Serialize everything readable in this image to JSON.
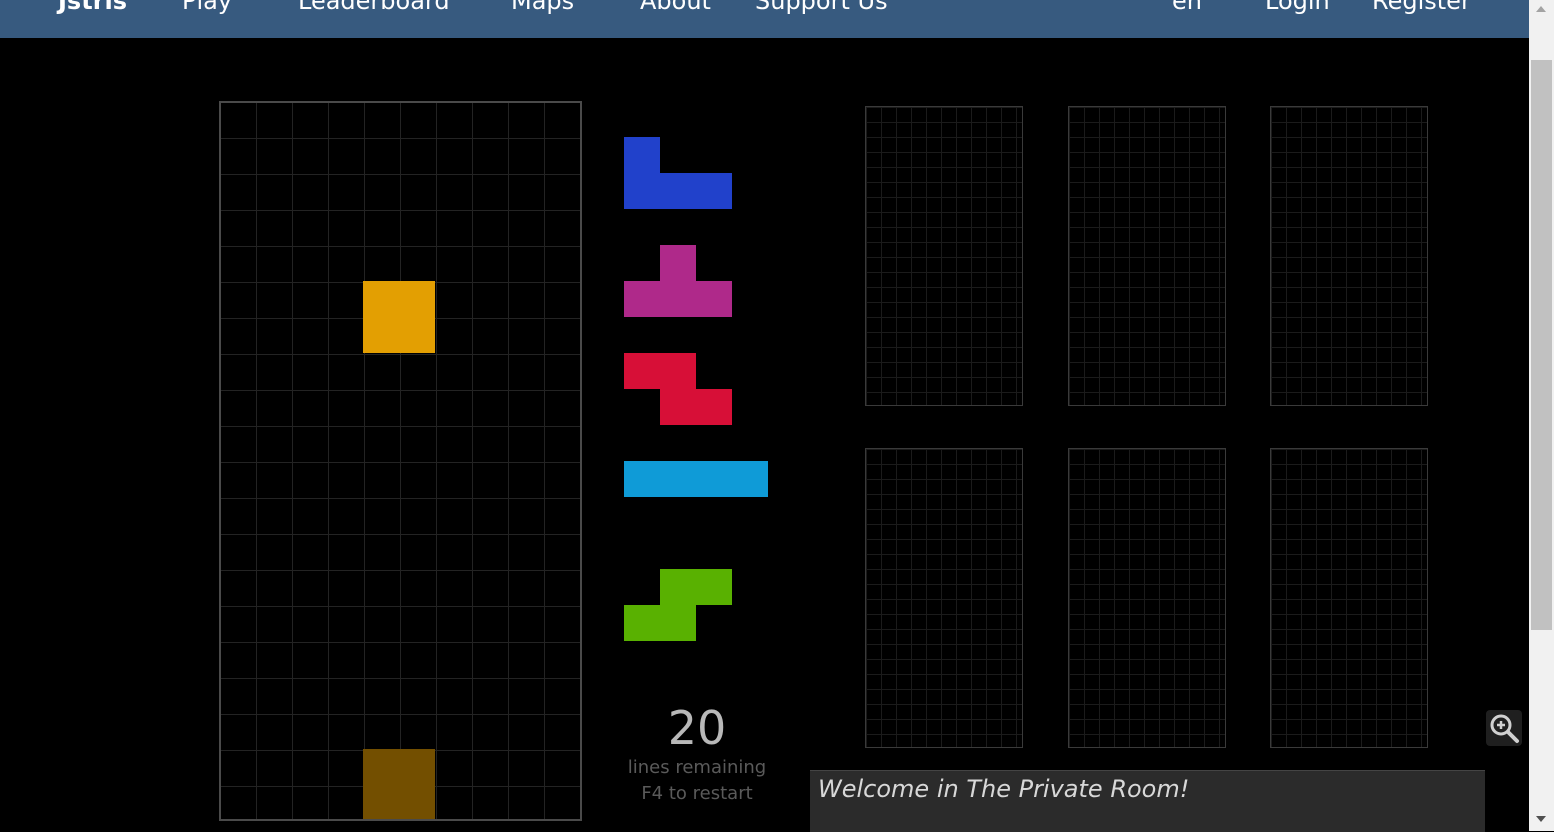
{
  "nav": {
    "brand": "Jstris",
    "links": [
      "Play",
      "Leaderboard",
      "Maps",
      "About",
      "Support Us"
    ],
    "right_links": [
      "en",
      "Login",
      "Register"
    ]
  },
  "colors": {
    "nav_bg": "#375a7f",
    "J": "#2141cb",
    "T": "#af298a",
    "Z": "#d70f37",
    "I": "#0f9bd7",
    "S": "#59b101",
    "O": "#e39f02",
    "O_ghost": "#734f00"
  },
  "game": {
    "active_piece": "O",
    "next_queue": [
      "J",
      "T",
      "Z",
      "I",
      "S"
    ],
    "lines_remaining": "20",
    "lines_label": "lines remaining",
    "restart_hint": "F4 to restart"
  },
  "chat": {
    "message": "Welcome in The Private Room!"
  },
  "icons": {
    "zoom": "zoom-in-icon"
  }
}
